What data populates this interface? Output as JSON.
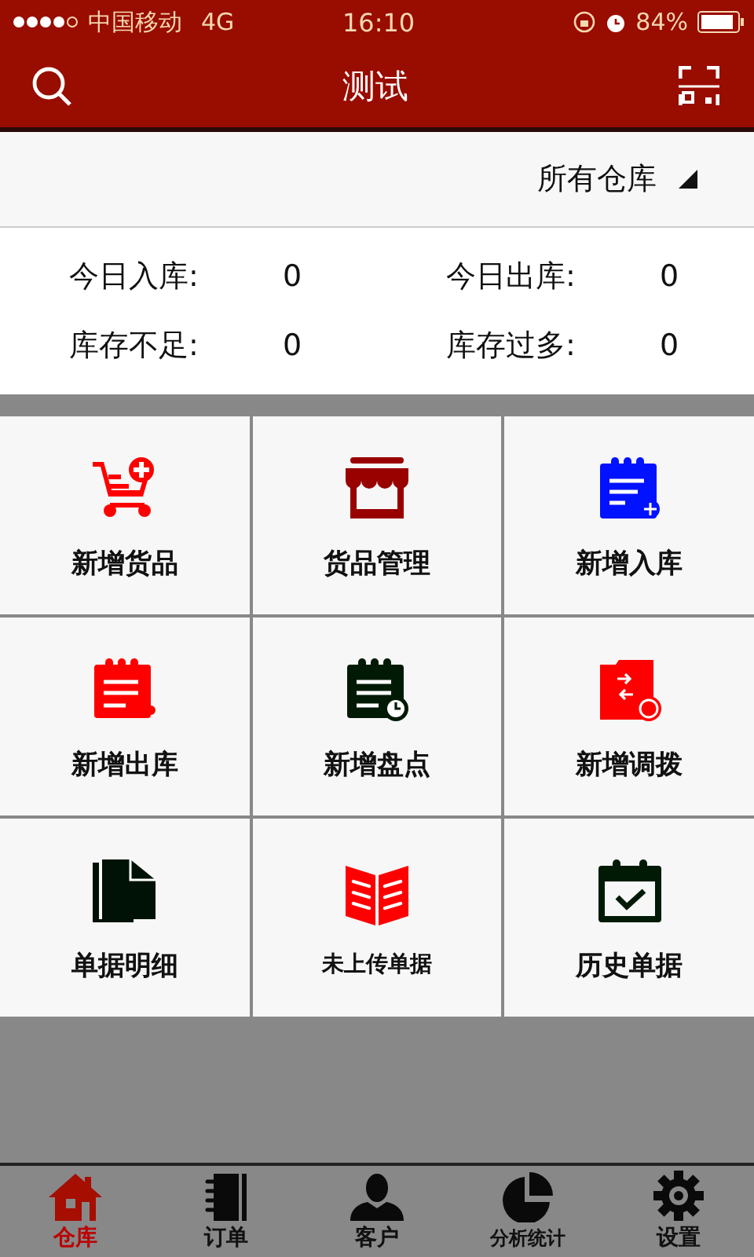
{
  "status_bar": {
    "carrier": "中国移动",
    "network": "4G",
    "time": "16:10",
    "battery": "84%"
  },
  "header": {
    "title": "测试"
  },
  "warehouse_filter": {
    "value": "所有仓库"
  },
  "stats": [
    {
      "label": "今日入库:",
      "value": "0"
    },
    {
      "label": "今日出库:",
      "value": "0"
    },
    {
      "label": "库存不足:",
      "value": "0"
    },
    {
      "label": "库存过多:",
      "value": "0"
    }
  ],
  "actions": [
    {
      "label": "新增货品"
    },
    {
      "label": "货品管理"
    },
    {
      "label": "新增入库"
    },
    {
      "label": "新增出库"
    },
    {
      "label": "新增盘点"
    },
    {
      "label": "新增调拨"
    },
    {
      "label": "单据明细"
    },
    {
      "label": "未上传单据",
      "small": true
    },
    {
      "label": "历史单据"
    }
  ],
  "tab_bar": [
    {
      "label": "仓库",
      "selected": true
    },
    {
      "label": "订单",
      "selected": false
    },
    {
      "label": "客户",
      "selected": false
    },
    {
      "label": "分析统计",
      "selected": false,
      "small": true
    },
    {
      "label": "设置",
      "selected": false
    }
  ]
}
